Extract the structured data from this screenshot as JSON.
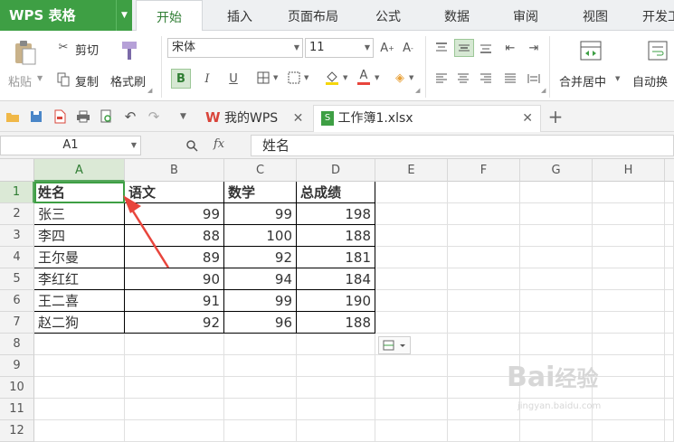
{
  "app": {
    "title": "WPS 表格"
  },
  "menu": {
    "tabs": [
      "开始",
      "插入",
      "页面布局",
      "公式",
      "数据",
      "审阅",
      "视图",
      "开发工"
    ],
    "active_index": 0
  },
  "ribbon": {
    "paste_label": "粘贴",
    "cut_label": "剪切",
    "copy_label": "复制",
    "format_painter_label": "格式刷",
    "font_name": "宋体",
    "font_size": "11",
    "bold": "B",
    "italic": "I",
    "underline": "U",
    "merge_label": "合并居中",
    "autowrap_label": "自动换"
  },
  "doc_tabs": [
    {
      "label": "我的WPS"
    },
    {
      "label": "工作簿1.xlsx"
    }
  ],
  "formula_bar": {
    "cell_ref": "A1",
    "fx": "fx",
    "content": "姓名"
  },
  "sheet": {
    "columns": [
      "A",
      "B",
      "C",
      "D",
      "E",
      "F",
      "G",
      "H"
    ],
    "rows": [
      "1",
      "2",
      "3",
      "4",
      "5",
      "6",
      "7",
      "8",
      "9",
      "10",
      "11",
      "12"
    ],
    "headers": [
      "姓名",
      "语文",
      "数学",
      "总成绩"
    ],
    "data": [
      [
        "张三",
        "99",
        "99",
        "198"
      ],
      [
        "李四",
        "88",
        "100",
        "188"
      ],
      [
        "王尔曼",
        "89",
        "92",
        "181"
      ],
      [
        "李红红",
        "90",
        "94",
        "184"
      ],
      [
        "王二喜",
        "91",
        "99",
        "190"
      ],
      [
        "赵二狗",
        "92",
        "96",
        "188"
      ]
    ]
  },
  "colors": {
    "accent": "#3e9f44",
    "arrow": "#e8453c"
  }
}
